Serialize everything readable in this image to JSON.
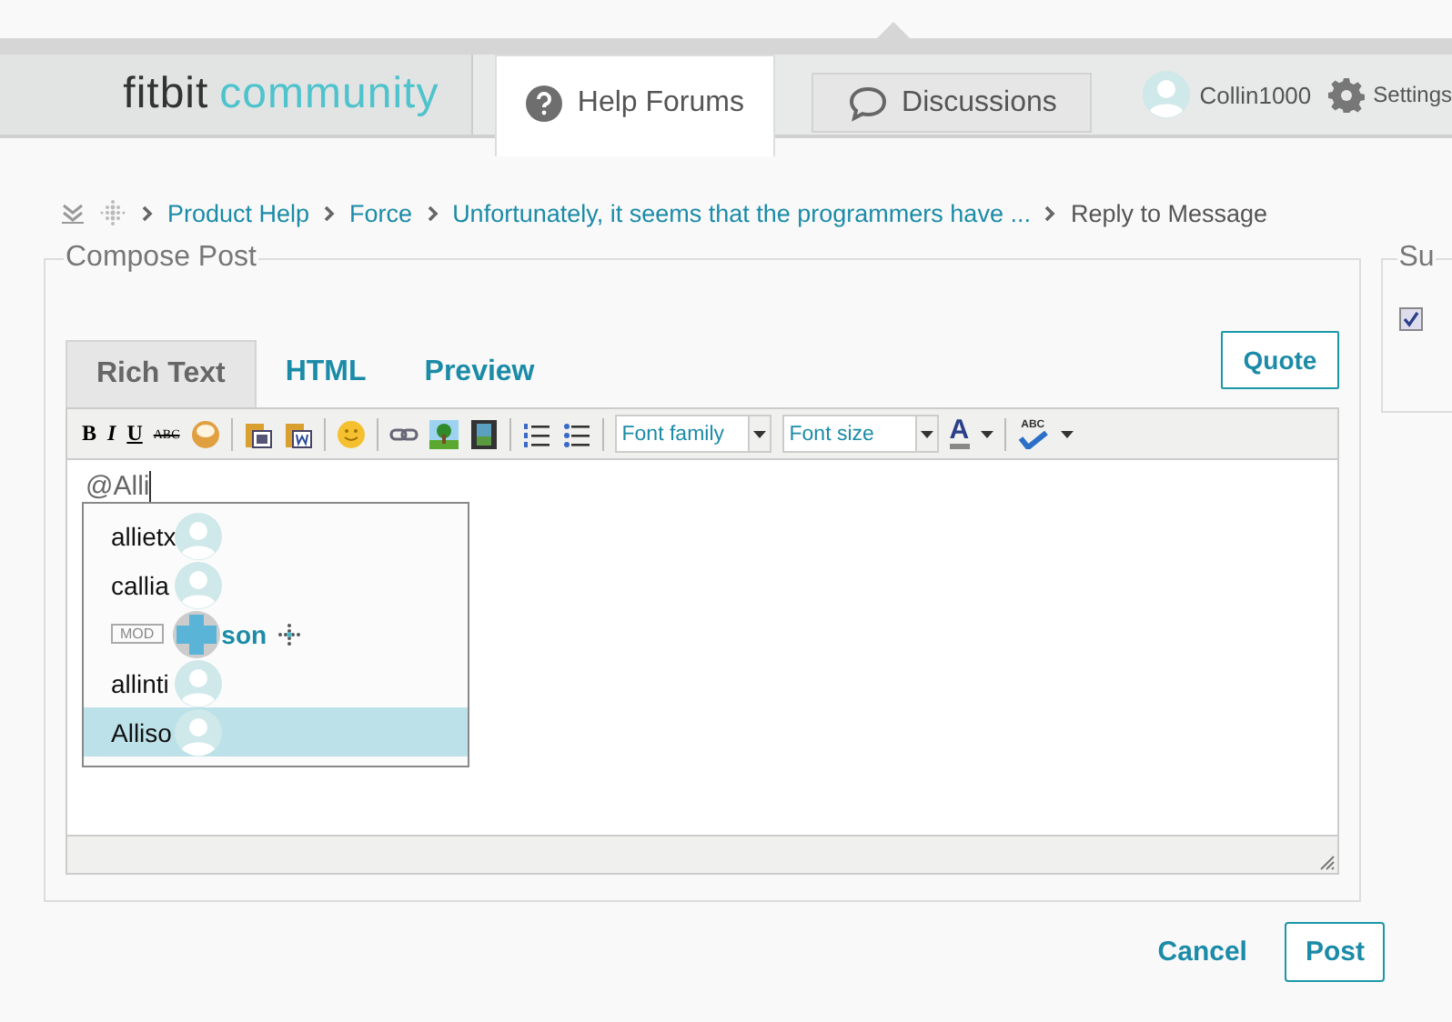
{
  "header": {
    "logo": {
      "word1": "fitbit",
      "word2": "community"
    },
    "tabs": [
      {
        "label": "Help Forums",
        "selected": true,
        "kind": "help"
      },
      {
        "label": "Discussions",
        "selected": false,
        "kind": "chat"
      }
    ],
    "user": "Collin1000",
    "settings": "Settings"
  },
  "breadcrumb": [
    {
      "label": "Product Help",
      "link": true
    },
    {
      "label": "Force",
      "link": true
    },
    {
      "label": "Unfortunately, it seems that the programmers have ...",
      "link": true
    },
    {
      "label": "Reply to Message",
      "link": false
    }
  ],
  "compose": {
    "legend": "Compose Post",
    "modes": [
      {
        "label": "Rich Text",
        "selected": true
      },
      {
        "label": "HTML",
        "selected": false
      },
      {
        "label": "Preview",
        "selected": false
      }
    ],
    "quote": "Quote",
    "toolbar": {
      "bold": "B",
      "italic": "I",
      "underline": "U",
      "strike": "ABC",
      "font_family": "Font family",
      "font_size": "Font size",
      "font_color_label": "A",
      "spell": "ABC"
    },
    "text": "@Alli",
    "mentions": [
      {
        "name": "allietx",
        "kind": "user",
        "selected": false
      },
      {
        "name": "callia",
        "kind": "user",
        "selected": false
      },
      {
        "name": "son",
        "badge": "MOD",
        "kind": "moderator",
        "selected": false
      },
      {
        "name": "allinti",
        "kind": "user",
        "selected": false
      },
      {
        "name": "Alliso",
        "kind": "user",
        "selected": true
      }
    ]
  },
  "side": {
    "legend": "Su",
    "checked": true
  },
  "actions": {
    "cancel": "Cancel",
    "post": "Post"
  }
}
